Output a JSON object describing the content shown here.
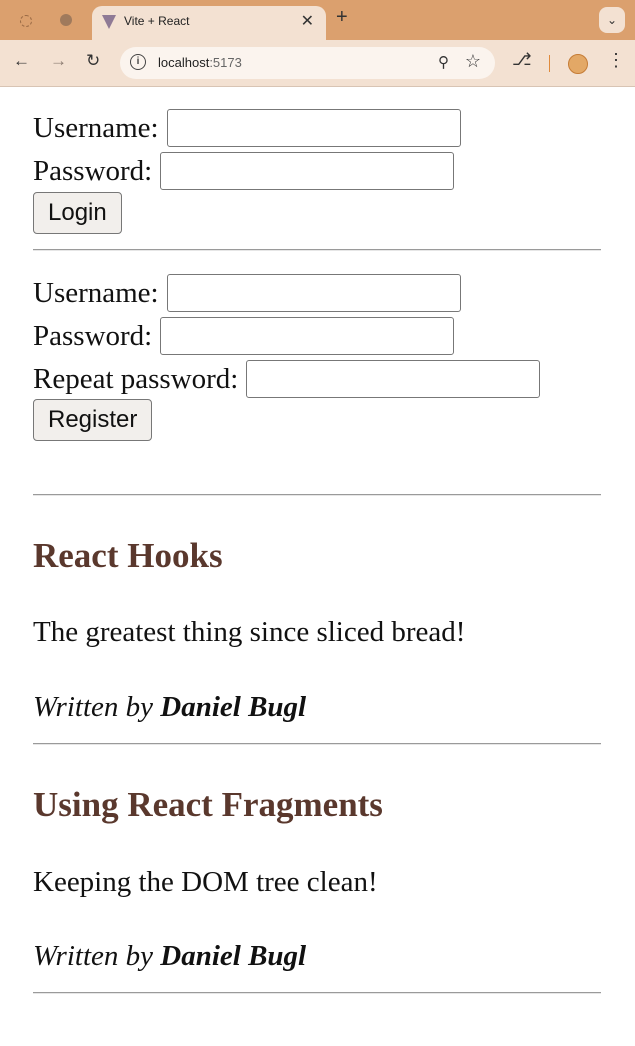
{
  "browser": {
    "tab_title": "Vite + React",
    "tab_close": "✕",
    "new_tab": "+",
    "url_host": "localhost",
    "url_port": ":5173",
    "icons": [
      "loading-icon",
      "favicon",
      "vite-favicon",
      "back-icon",
      "forward-icon",
      "reload-icon",
      "site-info-icon",
      "zoom-icon",
      "star-icon",
      "extensions-icon",
      "profile-avatar",
      "menu-icon"
    ]
  },
  "login": {
    "username_label": "Username:",
    "password_label": "Password:",
    "button_label": "Login"
  },
  "register": {
    "username_label": "Username:",
    "password_label": "Password:",
    "repeat_label": "Repeat password:",
    "button_label": "Register"
  },
  "posts": [
    {
      "title": "React Hooks",
      "content": "The greatest thing since sliced bread!",
      "written_by": "Written by",
      "author": "Daniel Bugl"
    },
    {
      "title": "Using React Fragments",
      "content": "Keeping the DOM tree clean!",
      "written_by": "Written by",
      "author": "Daniel Bugl"
    }
  ],
  "colors": {
    "tab_strip": "#dba06e",
    "toolbar": "#f3e1d2",
    "post_title": "#5a382d"
  }
}
